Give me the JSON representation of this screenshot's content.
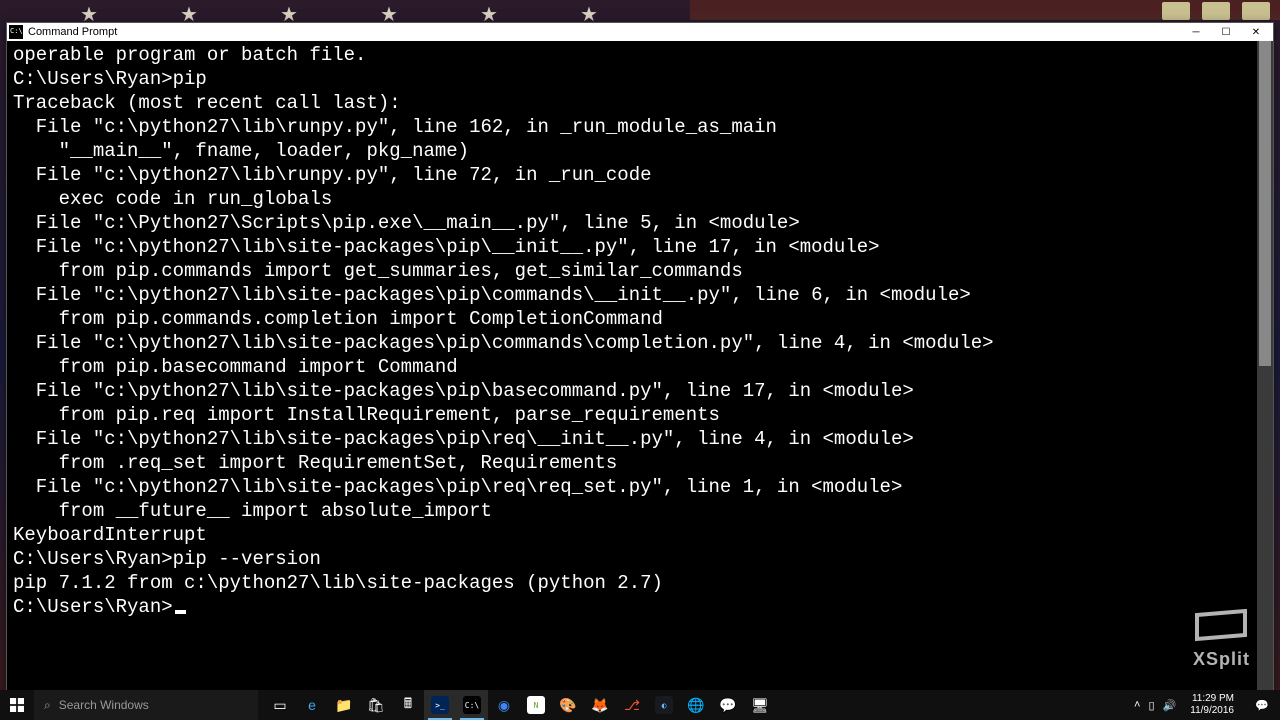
{
  "window": {
    "title": "Command Prompt"
  },
  "terminal": {
    "lines": [
      "operable program or batch file.",
      "",
      "C:\\Users\\Ryan>pip",
      "Traceback (most recent call last):",
      "  File \"c:\\python27\\lib\\runpy.py\", line 162, in _run_module_as_main",
      "    \"__main__\", fname, loader, pkg_name)",
      "  File \"c:\\python27\\lib\\runpy.py\", line 72, in _run_code",
      "    exec code in run_globals",
      "  File \"c:\\Python27\\Scripts\\pip.exe\\__main__.py\", line 5, in <module>",
      "  File \"c:\\python27\\lib\\site-packages\\pip\\__init__.py\", line 17, in <module>",
      "    from pip.commands import get_summaries, get_similar_commands",
      "  File \"c:\\python27\\lib\\site-packages\\pip\\commands\\__init__.py\", line 6, in <module>",
      "    from pip.commands.completion import CompletionCommand",
      "  File \"c:\\python27\\lib\\site-packages\\pip\\commands\\completion.py\", line 4, in <module>",
      "    from pip.basecommand import Command",
      "  File \"c:\\python27\\lib\\site-packages\\pip\\basecommand.py\", line 17, in <module>",
      "    from pip.req import InstallRequirement, parse_requirements",
      "  File \"c:\\python27\\lib\\site-packages\\pip\\req\\__init__.py\", line 4, in <module>",
      "    from .req_set import RequirementSet, Requirements",
      "  File \"c:\\python27\\lib\\site-packages\\pip\\req\\req_set.py\", line 1, in <module>",
      "    from __future__ import absolute_import",
      "KeyboardInterrupt",
      "",
      "C:\\Users\\Ryan>pip --version",
      "pip 7.1.2 from c:\\python27\\lib\\site-packages (python 2.7)",
      "",
      "C:\\Users\\Ryan>"
    ]
  },
  "watermark": {
    "label": "XSplit"
  },
  "taskbar": {
    "search_placeholder": "Search Windows",
    "icons": [
      {
        "name": "task-view-icon",
        "glyph": "▭",
        "color": "#fff",
        "bg": ""
      },
      {
        "name": "edge-icon",
        "glyph": "e",
        "color": "#3ba9ee",
        "bg": ""
      },
      {
        "name": "file-explorer-icon",
        "glyph": "📁",
        "color": "",
        "bg": ""
      },
      {
        "name": "store-icon",
        "glyph": "🛍",
        "color": "",
        "bg": ""
      },
      {
        "name": "calculator-icon",
        "glyph": "🖩",
        "color": "#fff",
        "bg": ""
      },
      {
        "name": "powershell-icon",
        "glyph": ">_",
        "color": "#fff",
        "bg": "#012456",
        "active": true
      },
      {
        "name": "command-prompt-icon",
        "glyph": "C:\\",
        "color": "#fff",
        "bg": "#000",
        "active": true
      },
      {
        "name": "chrome-icon",
        "glyph": "◉",
        "color": "#4285f4",
        "bg": ""
      },
      {
        "name": "notepadpp-icon",
        "glyph": "N",
        "color": "#6a9e3e",
        "bg": "#fff"
      },
      {
        "name": "psp-icon",
        "glyph": "🎨",
        "color": "",
        "bg": ""
      },
      {
        "name": "firefox-icon",
        "glyph": "🦊",
        "color": "",
        "bg": ""
      },
      {
        "name": "git-icon",
        "glyph": "⎇",
        "color": "#f05033",
        "bg": ""
      },
      {
        "name": "steam-icon",
        "glyph": "◐",
        "color": "#66c0f4",
        "bg": "#171a21"
      },
      {
        "name": "globe-icon",
        "glyph": "🌐",
        "color": "",
        "bg": ""
      },
      {
        "name": "chat-icon",
        "glyph": "💬",
        "color": "#7bb32e",
        "bg": ""
      },
      {
        "name": "monitor-icon",
        "glyph": "🖥",
        "color": "",
        "bg": ""
      }
    ]
  },
  "systray": {
    "time": "11:29 PM",
    "date": "11/9/2016"
  }
}
